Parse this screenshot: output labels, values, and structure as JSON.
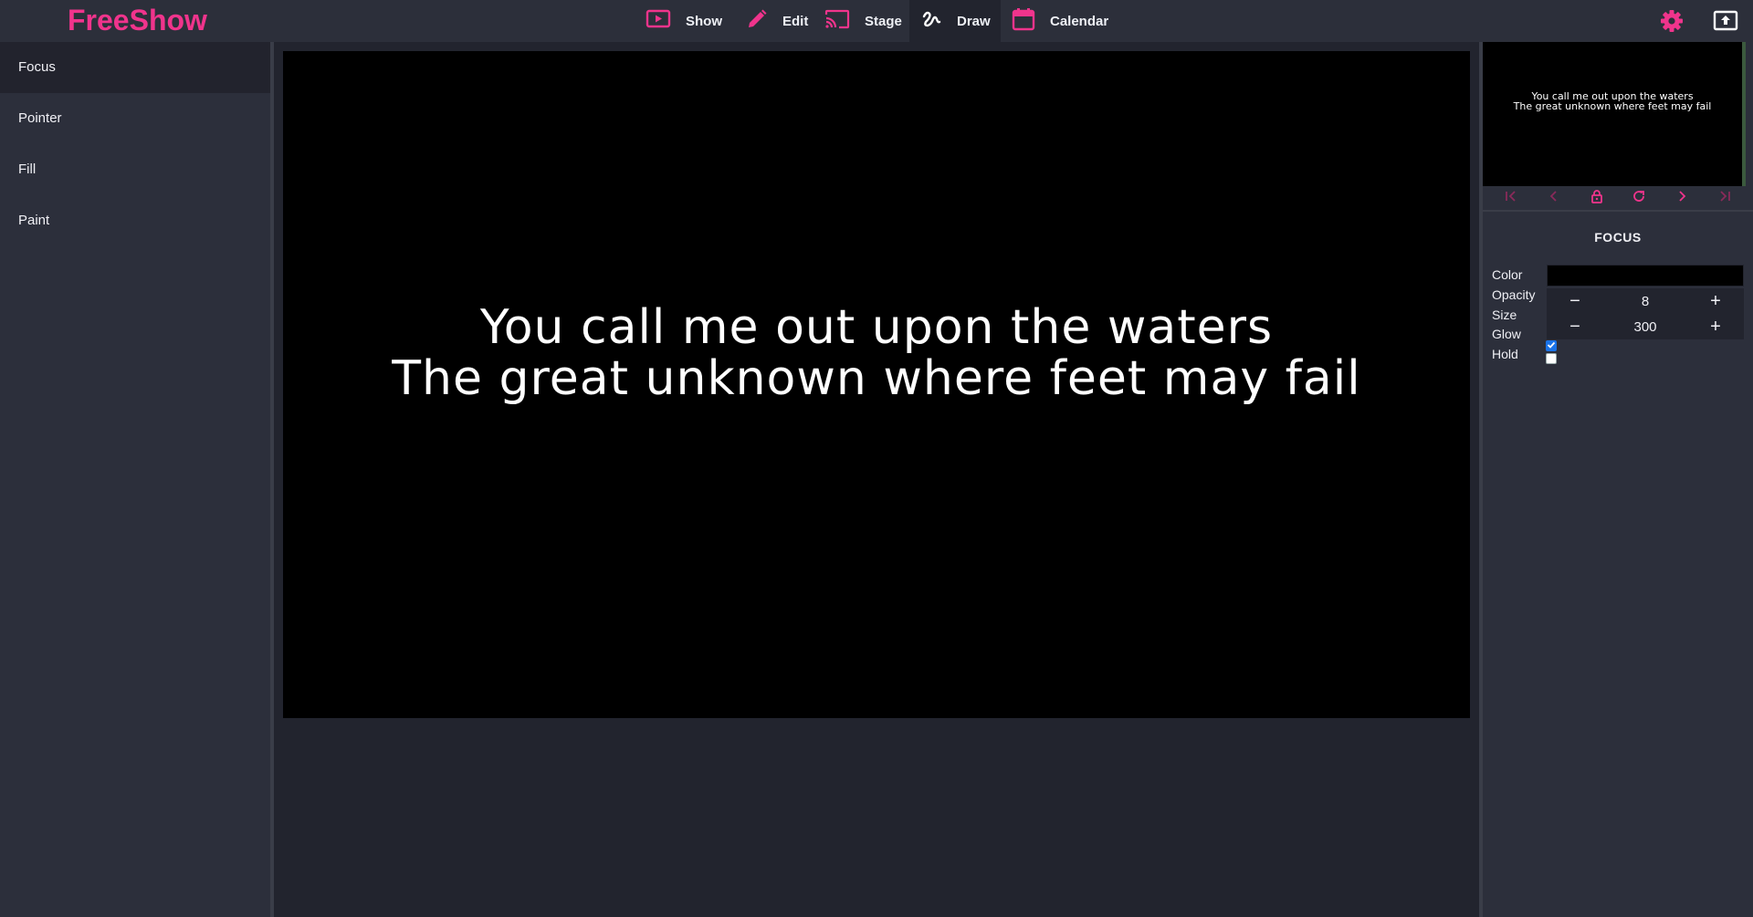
{
  "app": {
    "name": "FreeShow",
    "brand_color": "#f0348c"
  },
  "nav": {
    "show": "Show",
    "edit": "Edit",
    "stage": "Stage",
    "draw": "Draw",
    "calendar": "Calendar",
    "active": "Draw"
  },
  "tools": {
    "focus": "Focus",
    "pointer": "Pointer",
    "fill": "Fill",
    "paint": "Paint",
    "active": "Focus"
  },
  "slide": {
    "line1": "You call me out upon the waters",
    "line2": "The great unknown where feet may fail"
  },
  "properties": {
    "title": "FOCUS",
    "color_label": "Color",
    "color_value": "#000000",
    "opacity_label": "Opacity",
    "opacity_value": "8",
    "size_label": "Size",
    "size_value": "300",
    "glow_label": "Glow",
    "glow_checked": true,
    "hold_label": "Hold",
    "hold_checked": false,
    "minus": "−",
    "plus": "+"
  },
  "icons": {
    "show": "play-screen-icon",
    "edit": "pencil-icon",
    "stage": "cast-icon",
    "draw": "squiggle-icon",
    "calendar": "calendar-icon",
    "settings": "gear-icon",
    "output": "display-output-icon"
  }
}
